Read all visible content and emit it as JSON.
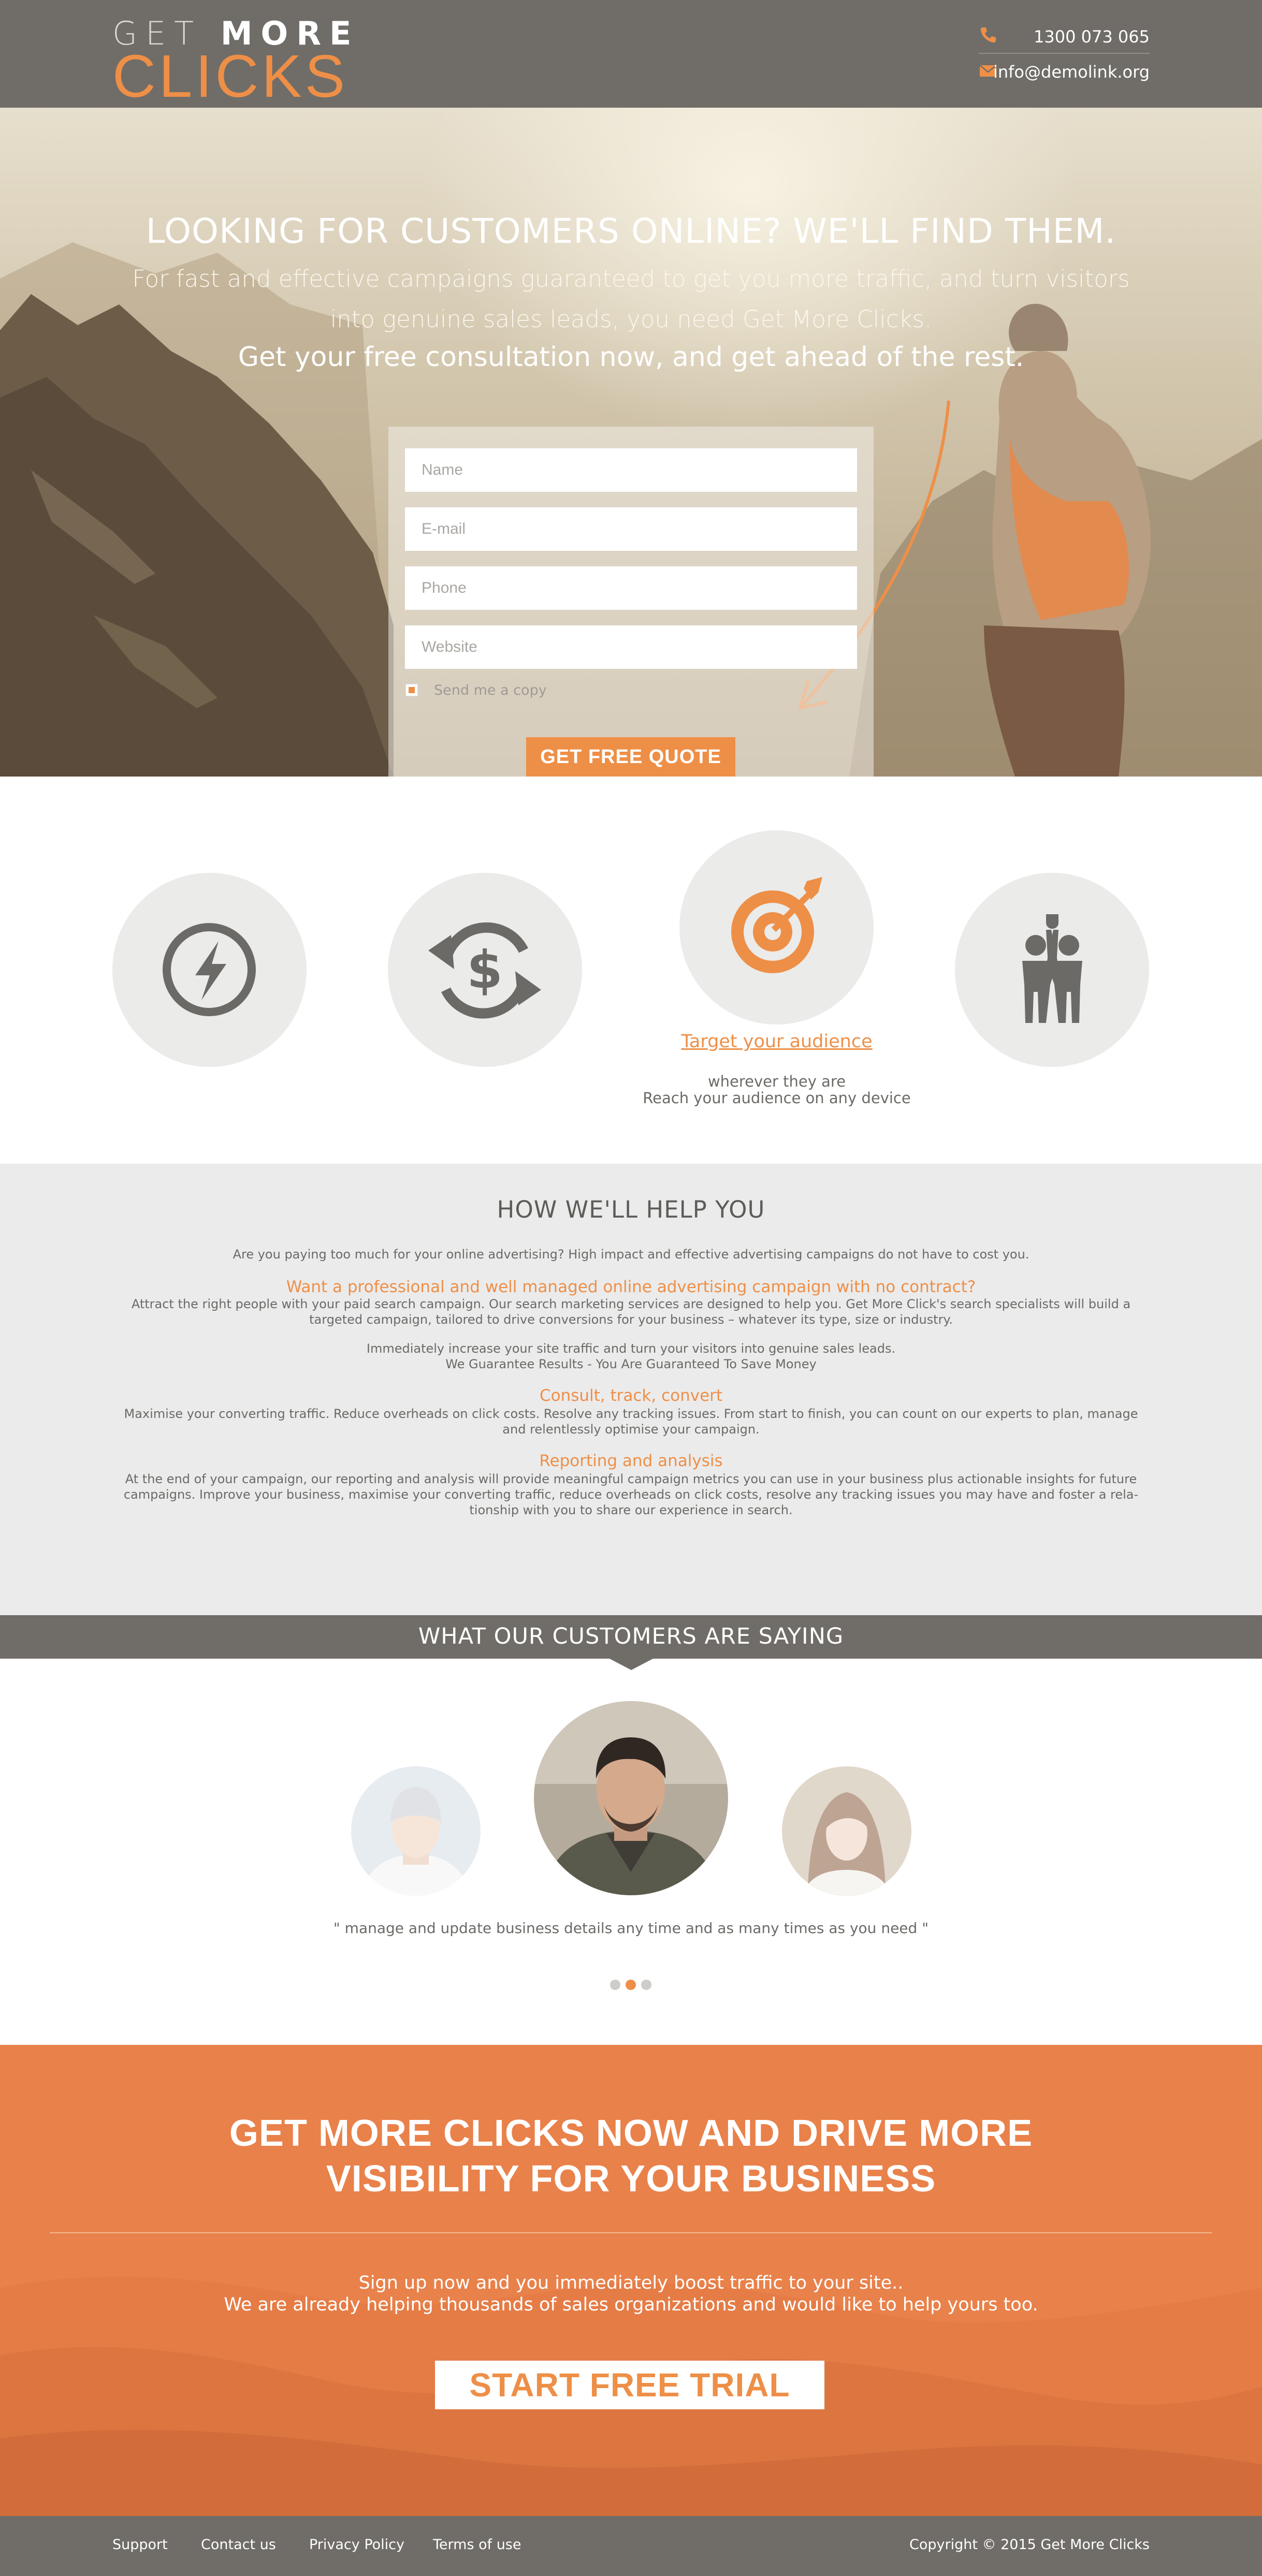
{
  "header": {
    "logo_line1_light": "GET",
    "logo_line1_bold": "MORE",
    "logo_line2": "CLICKS",
    "phone": "1300 073 065",
    "email": "info@demolink.org"
  },
  "hero": {
    "title": "LOOKING FOR CUSTOMERS ONLINE? WE'LL FIND THEM.",
    "subtitle_line1": "For fast and effective campaigns guaranteed to get you more traffic, and turn visitors",
    "subtitle_line2": "into genuine sales leads, you need Get More Clicks.",
    "cta": "Get your free consultation now, and get ahead of the rest."
  },
  "form": {
    "name_placeholder": "Name",
    "email_placeholder": "E-mail",
    "phone_placeholder": "Phone",
    "website_placeholder": "Website",
    "copy_label": "Send me a copy",
    "copy_checked": true,
    "submit_label": "GET FREE QUOTE"
  },
  "features": {
    "icons": [
      "lightning-icon",
      "dollar-cycle-icon",
      "target-icon",
      "teamwork-icon"
    ],
    "active_link": "Target your audience",
    "active_line1": "wherever they are",
    "active_line2": "Reach your audience on any device"
  },
  "help": {
    "title": "HOW WE'LL HELP YOU",
    "intro": "Are you paying too much for your online advertising? High impact and effective advertising campaigns do not have to cost you.",
    "section1_heading": "Want a professional and well managed online advertising campaign with no contract?",
    "section1_line1": "Attract the right people with your paid search campaign. Our search marketing services are designed to help you. Get More Click's search specialists will build a",
    "section1_line2": "targeted campaign, tailored to drive conversions for your business – whatever its type, size or industry.",
    "section1_line3": "Immediately increase your site traffic and turn your visitors into genuine sales leads.",
    "section1_line4": "We Guarantee Results - You Are Guaranteed To Save Money",
    "section2_heading": "Consult, track, convert",
    "section2_line1": "Maximise your converting traffic. Reduce overheads on click costs. Resolve any tracking issues. From start to finish, you can count on our experts to plan, manage",
    "section2_line2": "and relentlessly optimise your campaign.",
    "section3_heading": "Reporting and analysis",
    "section3_line1": "At the end of your campaign, our reporting and analysis will provide meaningful campaign metrics you can use in your business plus actionable insights for future",
    "section3_line2": "campaigns. Improve your business, maximise your converting traffic, reduce overheads on click costs, resolve any tracking issues you may have and foster a rela-",
    "section3_line3": "tionship with you to share our experience in search."
  },
  "testimonials": {
    "title": "WHAT OUR CUSTOMERS ARE SAYING",
    "quote": "\" manage and update business details any time and as many times as you need \"",
    "active_index": 1,
    "count": 3
  },
  "cta": {
    "title_line1": "GET MORE CLICKS NOW AND DRIVE MORE",
    "title_line2": "VISIBILITY FOR YOUR BUSINESS",
    "text_line1": "Sign up now and you immediately boost traffic to your site..",
    "text_line2": "We are already helping thousands of sales organizations and would like to help yours too.",
    "button_label": "START FREE TRIAL"
  },
  "footer": {
    "links": [
      "Support",
      "Contact us",
      "Privacy Policy",
      "Terms of use"
    ],
    "copyright": "Copyright © 2015 Get More Clicks"
  },
  "colors": {
    "accent": "#ee8f47",
    "header_bg": "#706d68",
    "section_gray": "#ebebeb",
    "cta_bg": "#e9814a"
  }
}
